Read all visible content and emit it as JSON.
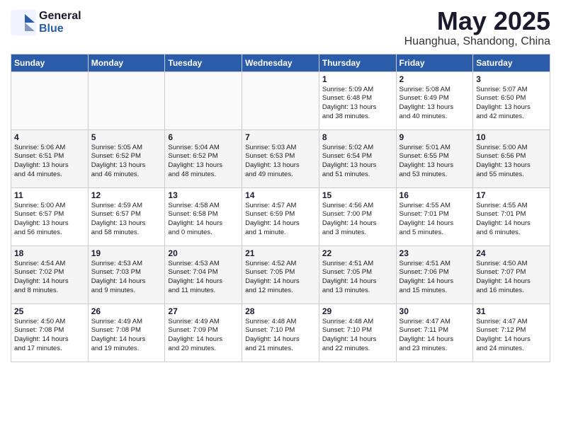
{
  "header": {
    "logo_general": "General",
    "logo_blue": "Blue",
    "month_title": "May 2025",
    "location": "Huanghua, Shandong, China"
  },
  "weekdays": [
    "Sunday",
    "Monday",
    "Tuesday",
    "Wednesday",
    "Thursday",
    "Friday",
    "Saturday"
  ],
  "weeks": [
    [
      {
        "day": "",
        "info": ""
      },
      {
        "day": "",
        "info": ""
      },
      {
        "day": "",
        "info": ""
      },
      {
        "day": "",
        "info": ""
      },
      {
        "day": "1",
        "info": "Sunrise: 5:09 AM\nSunset: 6:48 PM\nDaylight: 13 hours\nand 38 minutes."
      },
      {
        "day": "2",
        "info": "Sunrise: 5:08 AM\nSunset: 6:49 PM\nDaylight: 13 hours\nand 40 minutes."
      },
      {
        "day": "3",
        "info": "Sunrise: 5:07 AM\nSunset: 6:50 PM\nDaylight: 13 hours\nand 42 minutes."
      }
    ],
    [
      {
        "day": "4",
        "info": "Sunrise: 5:06 AM\nSunset: 6:51 PM\nDaylight: 13 hours\nand 44 minutes."
      },
      {
        "day": "5",
        "info": "Sunrise: 5:05 AM\nSunset: 6:52 PM\nDaylight: 13 hours\nand 46 minutes."
      },
      {
        "day": "6",
        "info": "Sunrise: 5:04 AM\nSunset: 6:52 PM\nDaylight: 13 hours\nand 48 minutes."
      },
      {
        "day": "7",
        "info": "Sunrise: 5:03 AM\nSunset: 6:53 PM\nDaylight: 13 hours\nand 49 minutes."
      },
      {
        "day": "8",
        "info": "Sunrise: 5:02 AM\nSunset: 6:54 PM\nDaylight: 13 hours\nand 51 minutes."
      },
      {
        "day": "9",
        "info": "Sunrise: 5:01 AM\nSunset: 6:55 PM\nDaylight: 13 hours\nand 53 minutes."
      },
      {
        "day": "10",
        "info": "Sunrise: 5:00 AM\nSunset: 6:56 PM\nDaylight: 13 hours\nand 55 minutes."
      }
    ],
    [
      {
        "day": "11",
        "info": "Sunrise: 5:00 AM\nSunset: 6:57 PM\nDaylight: 13 hours\nand 56 minutes."
      },
      {
        "day": "12",
        "info": "Sunrise: 4:59 AM\nSunset: 6:57 PM\nDaylight: 13 hours\nand 58 minutes."
      },
      {
        "day": "13",
        "info": "Sunrise: 4:58 AM\nSunset: 6:58 PM\nDaylight: 14 hours\nand 0 minutes."
      },
      {
        "day": "14",
        "info": "Sunrise: 4:57 AM\nSunset: 6:59 PM\nDaylight: 14 hours\nand 1 minute."
      },
      {
        "day": "15",
        "info": "Sunrise: 4:56 AM\nSunset: 7:00 PM\nDaylight: 14 hours\nand 3 minutes."
      },
      {
        "day": "16",
        "info": "Sunrise: 4:55 AM\nSunset: 7:01 PM\nDaylight: 14 hours\nand 5 minutes."
      },
      {
        "day": "17",
        "info": "Sunrise: 4:55 AM\nSunset: 7:01 PM\nDaylight: 14 hours\nand 6 minutes."
      }
    ],
    [
      {
        "day": "18",
        "info": "Sunrise: 4:54 AM\nSunset: 7:02 PM\nDaylight: 14 hours\nand 8 minutes."
      },
      {
        "day": "19",
        "info": "Sunrise: 4:53 AM\nSunset: 7:03 PM\nDaylight: 14 hours\nand 9 minutes."
      },
      {
        "day": "20",
        "info": "Sunrise: 4:53 AM\nSunset: 7:04 PM\nDaylight: 14 hours\nand 11 minutes."
      },
      {
        "day": "21",
        "info": "Sunrise: 4:52 AM\nSunset: 7:05 PM\nDaylight: 14 hours\nand 12 minutes."
      },
      {
        "day": "22",
        "info": "Sunrise: 4:51 AM\nSunset: 7:05 PM\nDaylight: 14 hours\nand 13 minutes."
      },
      {
        "day": "23",
        "info": "Sunrise: 4:51 AM\nSunset: 7:06 PM\nDaylight: 14 hours\nand 15 minutes."
      },
      {
        "day": "24",
        "info": "Sunrise: 4:50 AM\nSunset: 7:07 PM\nDaylight: 14 hours\nand 16 minutes."
      }
    ],
    [
      {
        "day": "25",
        "info": "Sunrise: 4:50 AM\nSunset: 7:08 PM\nDaylight: 14 hours\nand 17 minutes."
      },
      {
        "day": "26",
        "info": "Sunrise: 4:49 AM\nSunset: 7:08 PM\nDaylight: 14 hours\nand 19 minutes."
      },
      {
        "day": "27",
        "info": "Sunrise: 4:49 AM\nSunset: 7:09 PM\nDaylight: 14 hours\nand 20 minutes."
      },
      {
        "day": "28",
        "info": "Sunrise: 4:48 AM\nSunset: 7:10 PM\nDaylight: 14 hours\nand 21 minutes."
      },
      {
        "day": "29",
        "info": "Sunrise: 4:48 AM\nSunset: 7:10 PM\nDaylight: 14 hours\nand 22 minutes."
      },
      {
        "day": "30",
        "info": "Sunrise: 4:47 AM\nSunset: 7:11 PM\nDaylight: 14 hours\nand 23 minutes."
      },
      {
        "day": "31",
        "info": "Sunrise: 4:47 AM\nSunset: 7:12 PM\nDaylight: 14 hours\nand 24 minutes."
      }
    ]
  ]
}
